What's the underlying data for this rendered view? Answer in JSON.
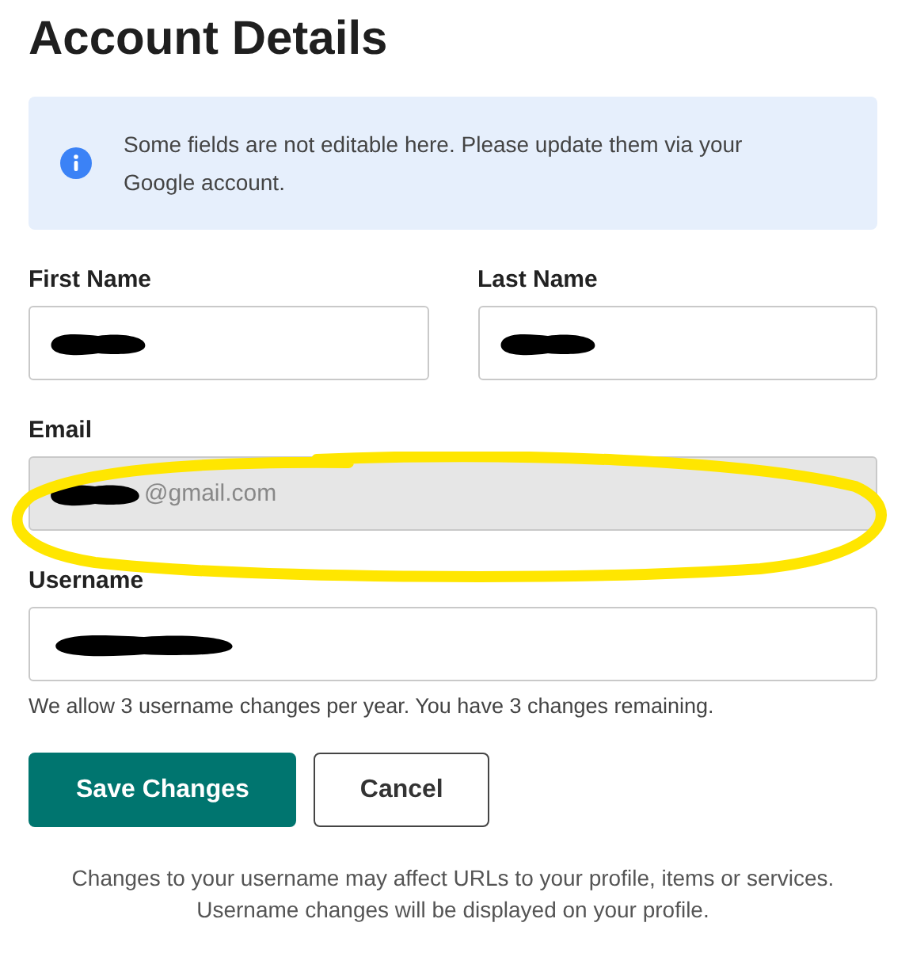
{
  "title": "Account Details",
  "notice": {
    "text": "Some fields are not editable here. Please update them via your Google account."
  },
  "field_rows": [
    {
      "fields": [
        {
          "label": "First Name",
          "redacted": true,
          "disabled": false
        },
        {
          "label": "Last Name",
          "redacted": true,
          "disabled": false
        }
      ]
    },
    {
      "fields": [
        {
          "label": "Email",
          "redacted": true,
          "value": "@gmail.com",
          "disabled": true,
          "highlighted": true
        }
      ]
    },
    {
      "fields": [
        {
          "label": "Username",
          "redacted": true,
          "disabled": false
        }
      ],
      "hint": "We allow 3 username changes per year. You have 3 changes remaining."
    }
  ],
  "buttons": [
    {
      "label": "Save Changes",
      "kind": "primary"
    },
    {
      "label": "Cancel",
      "kind": "secondary"
    }
  ],
  "footer": [
    "Changes to your username may affect URLs to your profile, items or services.",
    "Username changes will be displayed on your profile."
  ]
}
